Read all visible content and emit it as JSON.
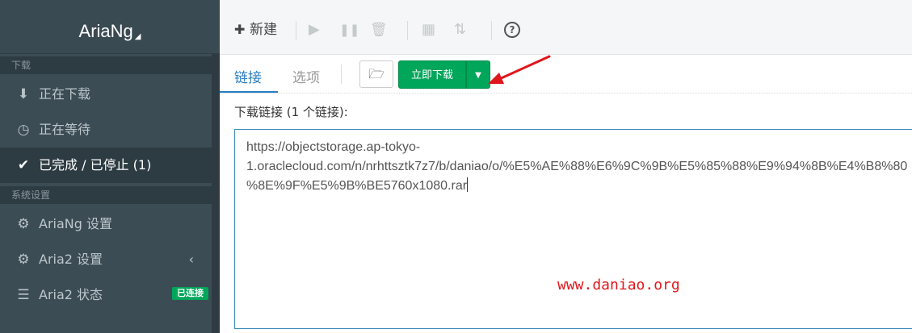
{
  "app": {
    "title": "AriaNg",
    "title_caret": "◢"
  },
  "sidebar": {
    "sections": [
      {
        "label": "下载"
      },
      {
        "label": "系统设置"
      }
    ],
    "items": [
      {
        "label": "正在下载",
        "icon": "download-circle-icon",
        "glyph": "⬇"
      },
      {
        "label": "正在等待",
        "icon": "clock-icon",
        "glyph": "◷"
      },
      {
        "label": "已完成 / 已停止 (1)",
        "icon": "check-circle-icon",
        "glyph": "✔"
      },
      {
        "label": "AriaNg 设置",
        "icon": "gear-icon",
        "glyph": "⚙"
      },
      {
        "label": "Aria2 设置",
        "icon": "gears-icon",
        "glyph": "⚙"
      },
      {
        "label": "Aria2 状态",
        "icon": "server-icon",
        "glyph": "☰"
      }
    ],
    "chevron": "‹",
    "status_badge": "已连接"
  },
  "toolbar": {
    "new_label": "新建",
    "new_glyph": "✚",
    "play_glyph": "▶",
    "pause_glyph": "❚❚",
    "delete_glyph": "🗑",
    "grid_glyph": "▦",
    "sort_glyph": "⇅",
    "help_glyph": "?"
  },
  "tabs": [
    {
      "label": "链接"
    },
    {
      "label": "选项"
    }
  ],
  "actions": {
    "folder_glyph": "🗁",
    "download_now": "立即下载",
    "dropdown_caret": "▼"
  },
  "links": {
    "label": "下载链接 (1 个链接):",
    "value": "https://objectstorage.ap-tokyo-\n1.oraclecloud.com/n/nrhttsztk7z7/b/daniao/o/%E5%AE%88%E6%9C%9B%E5%85%88%E9%94%8B%E4%B8%80\n%8E%9F%E5%9B%BE5760x1080.rar"
  },
  "watermark": "www.daniao.org",
  "colors": {
    "accent": "#00a65a",
    "link_blue": "#2a7dc0",
    "sidebar_bg": "#3c4c55",
    "annotation_red": "#e0171c"
  }
}
